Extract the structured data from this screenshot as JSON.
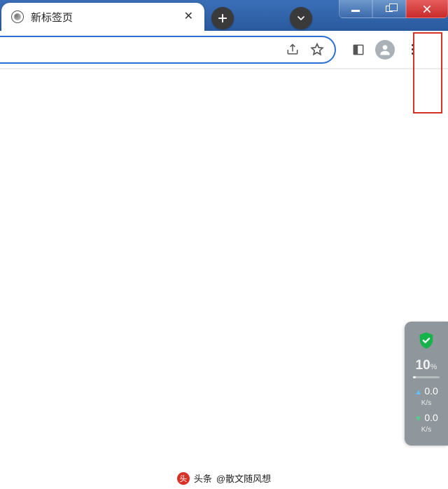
{
  "tab": {
    "title": "新标签页"
  },
  "widget": {
    "percent": "10",
    "percent_unit": "%",
    "up_value": "0.0",
    "up_unit": "K/s",
    "down_value": "0.0",
    "down_unit": "K/s"
  },
  "attribution": {
    "prefix": "头条",
    "handle": "@散文随风想"
  }
}
